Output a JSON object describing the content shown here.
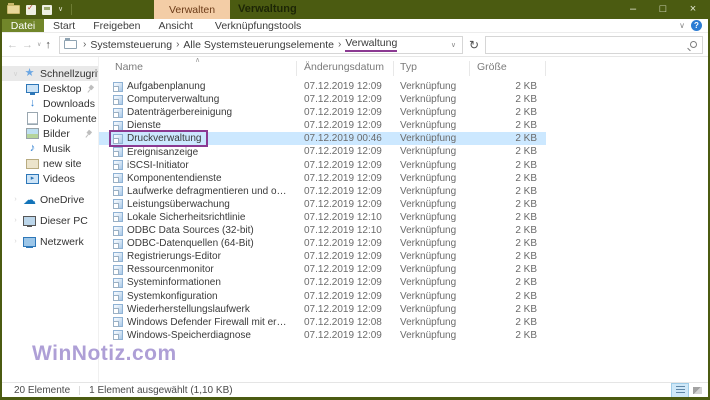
{
  "titlebar": {
    "title": "Verwaltung",
    "contextual_group": "Verwalten",
    "minimize_glyph": "–",
    "maximize_glyph": "□",
    "close_glyph": "×"
  },
  "ribbon": {
    "file_tab": "Datei",
    "tabs": [
      "Start",
      "Freigeben",
      "Ansicht"
    ],
    "contextual_tab": "Verknüpfungstools",
    "collapse_glyph": "∨",
    "help_glyph": "?"
  },
  "address_bar": {
    "back_glyph": "←",
    "forward_glyph": "→",
    "history_drop_glyph": "∨",
    "up_glyph": "↑",
    "breadcrumb_separator": "›",
    "breadcrumbs": [
      "Systemsteuerung",
      "Alle Systemsteuerungselemente",
      "Verwaltung"
    ],
    "annotated_crumb_index": 2,
    "field_drop_glyph": "∨",
    "refresh_glyph": "↻",
    "search_value": ""
  },
  "sidebar": {
    "groups": [
      {
        "label": "Schnellzugriff",
        "icon": "quick-access-star-icon",
        "selected": true,
        "expand_glyph": "∨",
        "children": [
          {
            "label": "Desktop",
            "icon": "desktop-icon",
            "pinned": true
          },
          {
            "label": "Downloads",
            "icon": "downloads-icon",
            "pinned": true
          },
          {
            "label": "Dokumente",
            "icon": "documents-icon",
            "pinned": true
          },
          {
            "label": "Bilder",
            "icon": "pictures-icon",
            "pinned": true
          },
          {
            "label": "Musik",
            "icon": "music-icon",
            "pinned": false
          },
          {
            "label": "new site",
            "icon": "folder-icon",
            "pinned": false
          },
          {
            "label": "Videos",
            "icon": "videos-icon",
            "pinned": false
          }
        ]
      },
      {
        "label": "OneDrive",
        "icon": "onedrive-cloud-icon",
        "selected": false,
        "expand_glyph": "›",
        "children": []
      },
      {
        "label": "Dieser PC",
        "icon": "this-pc-icon",
        "selected": false,
        "expand_glyph": "›",
        "children": []
      },
      {
        "label": "Netzwerk",
        "icon": "network-icon",
        "selected": false,
        "expand_glyph": "›",
        "children": []
      }
    ],
    "icon_glyphs": {
      "quick-access-star-icon": "★",
      "downloads-icon": "↓",
      "music-icon": "♪",
      "onedrive-cloud-icon": "☁"
    }
  },
  "files": {
    "columns": [
      "Name",
      "Änderungsdatum",
      "Typ",
      "Größe"
    ],
    "sort_glyph": "∧",
    "selected_index": 4,
    "rows": [
      {
        "name": "Aufgabenplanung",
        "date": "07.12.2019 12:09",
        "type": "Verknüpfung",
        "size": "2 KB"
      },
      {
        "name": "Computerverwaltung",
        "date": "07.12.2019 12:09",
        "type": "Verknüpfung",
        "size": "2 KB"
      },
      {
        "name": "Datenträgerbereinigung",
        "date": "07.12.2019 12:09",
        "type": "Verknüpfung",
        "size": "2 KB"
      },
      {
        "name": "Dienste",
        "date": "07.12.2019 12:09",
        "type": "Verknüpfung",
        "size": "2 KB"
      },
      {
        "name": "Druckverwaltung",
        "date": "07.12.2019 00:46",
        "type": "Verknüpfung",
        "size": "2 KB"
      },
      {
        "name": "Ereignisanzeige",
        "date": "07.12.2019 12:09",
        "type": "Verknüpfung",
        "size": "2 KB"
      },
      {
        "name": "iSCSI-Initiator",
        "date": "07.12.2019 12:09",
        "type": "Verknüpfung",
        "size": "2 KB"
      },
      {
        "name": "Komponentendienste",
        "date": "07.12.2019 12:09",
        "type": "Verknüpfung",
        "size": "2 KB"
      },
      {
        "name": "Laufwerke defragmentieren und optimieren",
        "date": "07.12.2019 12:09",
        "type": "Verknüpfung",
        "size": "2 KB"
      },
      {
        "name": "Leistungsüberwachung",
        "date": "07.12.2019 12:09",
        "type": "Verknüpfung",
        "size": "2 KB"
      },
      {
        "name": "Lokale Sicherheitsrichtlinie",
        "date": "07.12.2019 12:10",
        "type": "Verknüpfung",
        "size": "2 KB"
      },
      {
        "name": "ODBC Data Sources (32-bit)",
        "date": "07.12.2019 12:10",
        "type": "Verknüpfung",
        "size": "2 KB"
      },
      {
        "name": "ODBC-Datenquellen (64-Bit)",
        "date": "07.12.2019 12:09",
        "type": "Verknüpfung",
        "size": "2 KB"
      },
      {
        "name": "Registrierungs-Editor",
        "date": "07.12.2019 12:09",
        "type": "Verknüpfung",
        "size": "2 KB"
      },
      {
        "name": "Ressourcenmonitor",
        "date": "07.12.2019 12:09",
        "type": "Verknüpfung",
        "size": "2 KB"
      },
      {
        "name": "Systeminformationen",
        "date": "07.12.2019 12:09",
        "type": "Verknüpfung",
        "size": "2 KB"
      },
      {
        "name": "Systemkonfiguration",
        "date": "07.12.2019 12:09",
        "type": "Verknüpfung",
        "size": "2 KB"
      },
      {
        "name": "Wiederherstellungslaufwerk",
        "date": "07.12.2019 12:09",
        "type": "Verknüpfung",
        "size": "2 KB"
      },
      {
        "name": "Windows Defender Firewall mit erweiterter Sich...",
        "date": "07.12.2019 12:08",
        "type": "Verknüpfung",
        "size": "2 KB"
      },
      {
        "name": "Windows-Speicherdiagnose",
        "date": "07.12.2019 12:09",
        "type": "Verknüpfung",
        "size": "2 KB"
      }
    ]
  },
  "status_bar": {
    "count": "20 Elemente",
    "selection": "1 Element ausgewählt (1,10 KB)"
  },
  "watermark": "WinNotiz.com",
  "colors": {
    "titlebar_green": "#4b5b11",
    "file_tab_green": "#71862a",
    "contextual_peach": "#f3cda6",
    "selection_blue": "#cce8ff",
    "annotation_purple": "#8b3a92",
    "watermark_purple": "#a08fd0"
  }
}
